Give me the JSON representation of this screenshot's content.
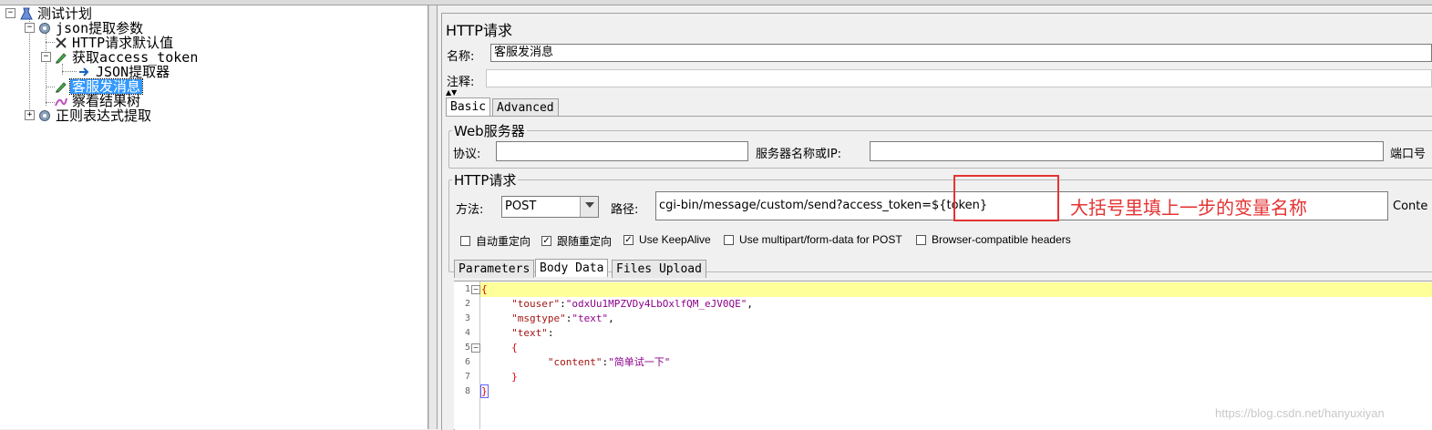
{
  "tree": {
    "items": [
      {
        "label": "测试计划",
        "icon": "test-plan-icon"
      },
      {
        "label": "json提取参数",
        "icon": "thread-group-gear-icon"
      },
      {
        "label": "HTTP请求默认值",
        "icon": "scissors-config-icon"
      },
      {
        "label": "获取access_token",
        "icon": "pencil-sampler-icon"
      },
      {
        "label": "JSON提取器",
        "icon": "arrow-extractor-icon"
      },
      {
        "label": "客服发消息",
        "icon": "pencil-sampler-icon",
        "selected": true
      },
      {
        "label": "察看结果树",
        "icon": "listener-graph-icon"
      },
      {
        "label": "正则表达式提取",
        "icon": "thread-group-gear-icon"
      }
    ]
  },
  "panel": {
    "title": "HTTP请求",
    "name_label": "名称:",
    "name_value": "客服发消息",
    "comment_label": "注释:",
    "comment_value": ""
  },
  "tabs_top": {
    "basic": "Basic",
    "advanced": "Advanced"
  },
  "web_server": {
    "legend": "Web服务器",
    "protocol_label": "协议:",
    "protocol_value": "",
    "server_label": "服务器名称或IP:",
    "server_value": "",
    "port_label": "端口号"
  },
  "http_request": {
    "legend": "HTTP请求",
    "method_label": "方法:",
    "method_value": "POST",
    "path_label": "路径:",
    "path_value": "cgi-bin/message/custom/send?access_token=${token}",
    "content_label": "Conte"
  },
  "options": [
    {
      "label": "自动重定向",
      "checked": false
    },
    {
      "label": "跟随重定向",
      "checked": true
    },
    {
      "label": "Use KeepAlive",
      "checked": true
    },
    {
      "label": "Use multipart/form-data for POST",
      "checked": false
    },
    {
      "label": "Browser-compatible headers",
      "checked": false
    }
  ],
  "tabs_body": {
    "parameters": "Parameters",
    "body_data": "Body Data",
    "files_upload": "Files Upload"
  },
  "editor": {
    "line_numbers": [
      "1",
      "2",
      "3",
      "4",
      "5",
      "6",
      "7",
      "8"
    ],
    "line1": "{",
    "l2_key": "\"touser\"",
    "l2_val": "\"odxUu1MPZVDy4LbOxlfQM_eJV0QE\"",
    "l3_key": "\"msgtype\"",
    "l3_val": "\"text\"",
    "l4_key": "\"text\"",
    "line5": "{",
    "l6_key": "\"content\"",
    "l6_val": "\"简单试一下\"",
    "line7": "}",
    "line8": "}",
    "colon": ":",
    "comma": ","
  },
  "annotation": "大括号里填上一步的变量名称",
  "watermark": "https://blog.csdn.net/hanyuxiyan",
  "colors": {
    "selection": "#3399ff",
    "annotation_red": "#e53333",
    "highlight_line": "#ffff99",
    "json_key": "#a31515",
    "json_string": "#8b008b"
  }
}
